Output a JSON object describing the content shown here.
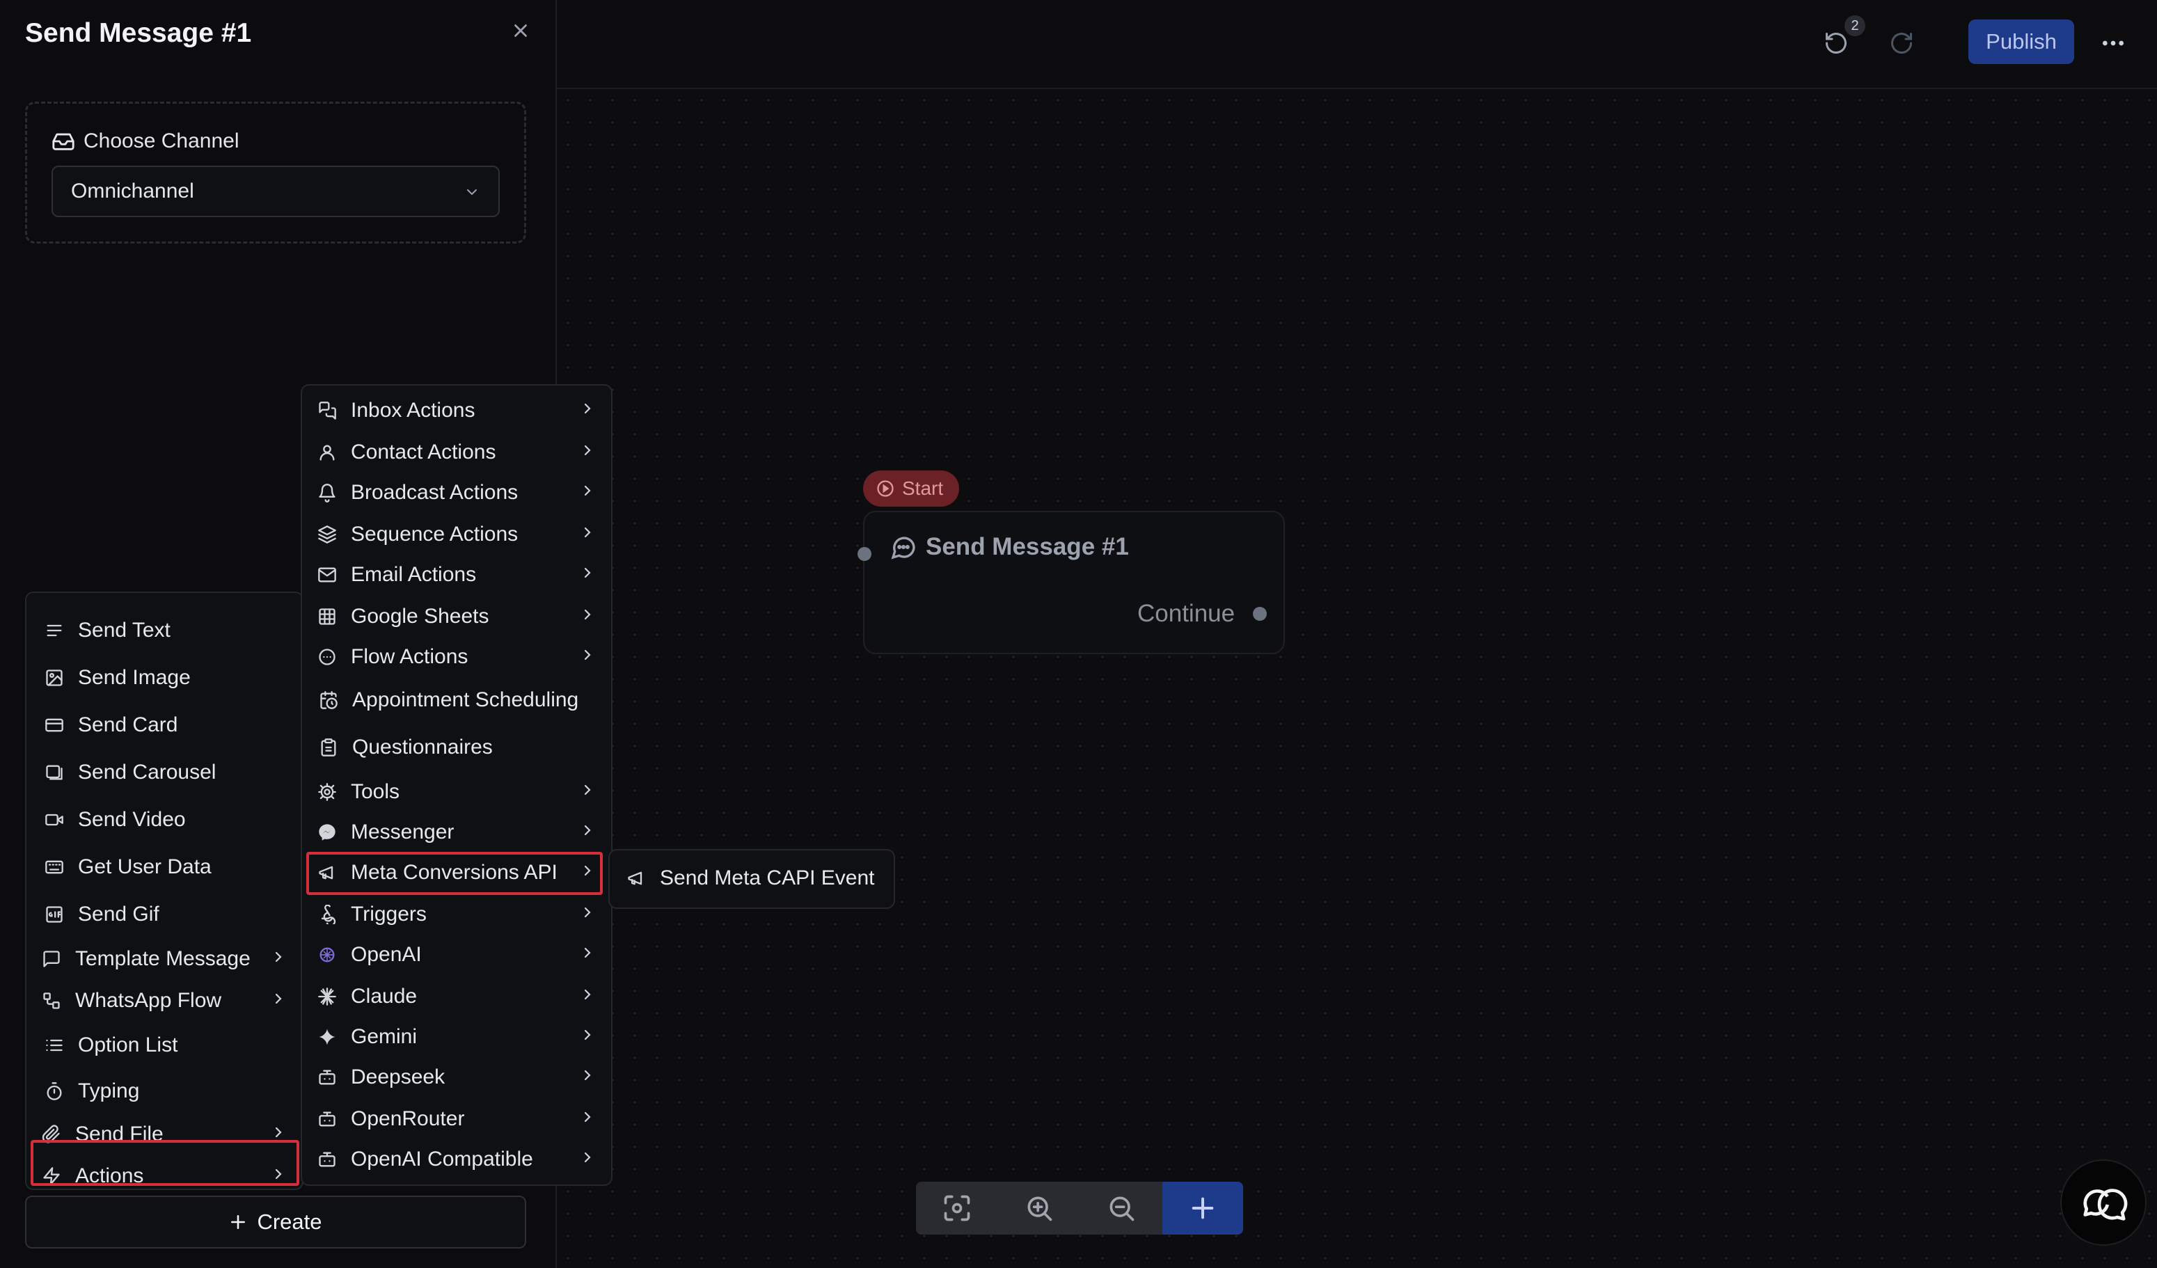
{
  "panel": {
    "title": "Send Message #1",
    "channel_label": "Choose Channel",
    "channel_value": "Omnichannel",
    "create_label": "Create"
  },
  "topbar": {
    "undo_count": "2",
    "publish_label": "Publish"
  },
  "menu_left": {
    "items": [
      {
        "label": "Send Text",
        "icon": "text-lines-icon"
      },
      {
        "label": "Send Image",
        "icon": "image-icon"
      },
      {
        "label": "Send Card",
        "icon": "card-icon"
      },
      {
        "label": "Send Carousel",
        "icon": "carousel-icon"
      },
      {
        "label": "Send Video",
        "icon": "video-icon"
      },
      {
        "label": "Get User Data",
        "icon": "keyboard-icon"
      },
      {
        "label": "Send Gif",
        "icon": "gif-icon"
      },
      {
        "label": "Template Message",
        "icon": "message-square-icon"
      },
      {
        "label": "WhatsApp Flow",
        "icon": "workflow-icon"
      },
      {
        "label": "Option List",
        "icon": "list-icon"
      },
      {
        "label": "Typing",
        "icon": "timer-icon"
      },
      {
        "label": "Send File",
        "icon": "paperclip-icon"
      },
      {
        "label": "Actions",
        "icon": "zap-icon"
      }
    ]
  },
  "menu_mid": {
    "items": [
      {
        "label": "Inbox Actions",
        "icon": "messages-icon"
      },
      {
        "label": "Contact Actions",
        "icon": "user-icon"
      },
      {
        "label": "Broadcast Actions",
        "icon": "bell-icon"
      },
      {
        "label": "Sequence Actions",
        "icon": "layers-icon"
      },
      {
        "label": "Email Actions",
        "icon": "mail-icon"
      },
      {
        "label": "Google Sheets",
        "icon": "sheet-icon"
      },
      {
        "label": "Flow Actions",
        "icon": "circle-dots-icon"
      },
      {
        "label": "Appointment Scheduling",
        "icon": "calendar-clock-icon"
      },
      {
        "label": "Questionnaires",
        "icon": "clipboard-icon"
      },
      {
        "label": "Tools",
        "icon": "cog-icon"
      },
      {
        "label": "Messenger",
        "icon": "messenger-icon"
      },
      {
        "label": "Meta Conversions API",
        "icon": "megaphone-icon"
      },
      {
        "label": "Triggers",
        "icon": "webhook-icon"
      },
      {
        "label": "OpenAI",
        "icon": "openai-icon"
      },
      {
        "label": "Claude",
        "icon": "claude-icon"
      },
      {
        "label": "Gemini",
        "icon": "gemini-icon"
      },
      {
        "label": "Deepseek",
        "icon": "bot-icon"
      },
      {
        "label": "OpenRouter",
        "icon": "bot-icon"
      },
      {
        "label": "OpenAI Compatible",
        "icon": "bot-icon"
      }
    ]
  },
  "menu_sub": {
    "items": [
      {
        "label": "Send Meta CAPI Event",
        "icon": "megaphone-icon"
      }
    ]
  },
  "node": {
    "start_label": "Start",
    "title": "Send Message #1",
    "continue_label": "Continue"
  },
  "colors": {
    "accent": "#1e3a8a",
    "highlight": "#d62f3c",
    "start": "#6b2126"
  }
}
